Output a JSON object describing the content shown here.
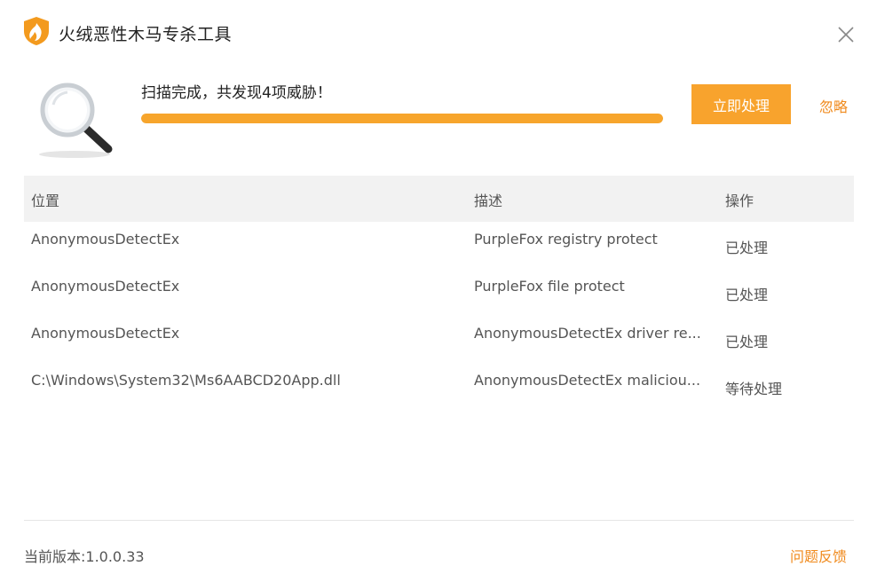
{
  "window": {
    "title": "火绒恶性木马专杀工具"
  },
  "scan": {
    "status_text": "扫描完成，共发现4项威胁！",
    "progress": 1.0,
    "primary_action_label": "立即处理",
    "ignore_label": "忽略"
  },
  "table": {
    "columns": [
      "位置",
      "描述",
      "操作"
    ],
    "rows": [
      {
        "location": "AnonymousDetectEx",
        "description": "PurpleFox registry protect",
        "action": "已处理"
      },
      {
        "location": "AnonymousDetectEx",
        "description": "PurpleFox file protect",
        "action": "已处理"
      },
      {
        "location": "AnonymousDetectEx",
        "description": "AnonymousDetectEx driver re...",
        "action": "已处理"
      },
      {
        "location": "C:\\Windows\\System32\\Ms6AABCD20App.dll",
        "description": "AnonymousDetectEx maliciou...",
        "action": "等待处理"
      }
    ]
  },
  "footer": {
    "version_text": "当前版本:1.0.0.33",
    "feedback_label": "问题反馈"
  },
  "icons": {
    "logo": "huorong-flame-logo-icon",
    "close": "close-icon",
    "scan": "magnifier-icon"
  },
  "colors": {
    "accent": "#f8a32d",
    "link": "#f08a1c"
  }
}
